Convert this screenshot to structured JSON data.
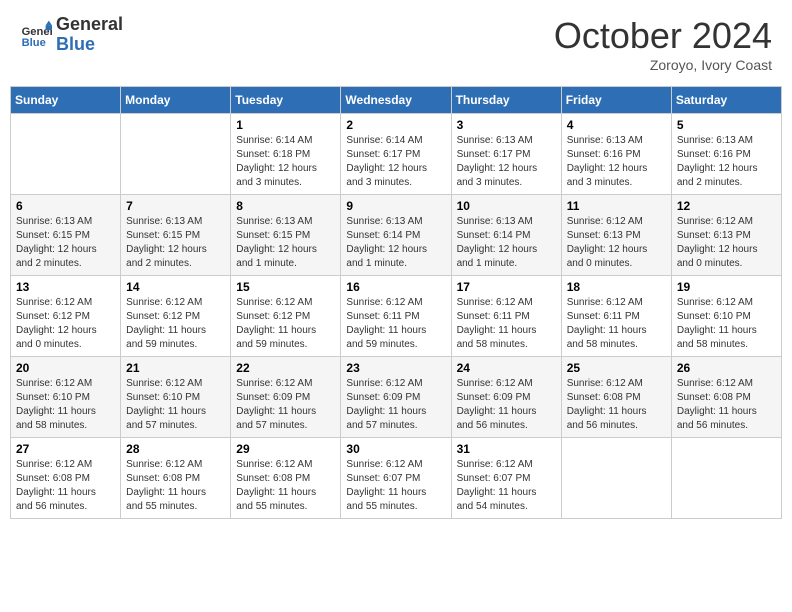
{
  "header": {
    "logo_line1": "General",
    "logo_line2": "Blue",
    "month": "October 2024",
    "location": "Zoroyo, Ivory Coast"
  },
  "days_of_week": [
    "Sunday",
    "Monday",
    "Tuesday",
    "Wednesday",
    "Thursday",
    "Friday",
    "Saturday"
  ],
  "weeks": [
    [
      {
        "day": "",
        "info": ""
      },
      {
        "day": "",
        "info": ""
      },
      {
        "day": "1",
        "info": "Sunrise: 6:14 AM\nSunset: 6:18 PM\nDaylight: 12 hours and 3 minutes."
      },
      {
        "day": "2",
        "info": "Sunrise: 6:14 AM\nSunset: 6:17 PM\nDaylight: 12 hours and 3 minutes."
      },
      {
        "day": "3",
        "info": "Sunrise: 6:13 AM\nSunset: 6:17 PM\nDaylight: 12 hours and 3 minutes."
      },
      {
        "day": "4",
        "info": "Sunrise: 6:13 AM\nSunset: 6:16 PM\nDaylight: 12 hours and 3 minutes."
      },
      {
        "day": "5",
        "info": "Sunrise: 6:13 AM\nSunset: 6:16 PM\nDaylight: 12 hours and 2 minutes."
      }
    ],
    [
      {
        "day": "6",
        "info": "Sunrise: 6:13 AM\nSunset: 6:15 PM\nDaylight: 12 hours and 2 minutes."
      },
      {
        "day": "7",
        "info": "Sunrise: 6:13 AM\nSunset: 6:15 PM\nDaylight: 12 hours and 2 minutes."
      },
      {
        "day": "8",
        "info": "Sunrise: 6:13 AM\nSunset: 6:15 PM\nDaylight: 12 hours and 1 minute."
      },
      {
        "day": "9",
        "info": "Sunrise: 6:13 AM\nSunset: 6:14 PM\nDaylight: 12 hours and 1 minute."
      },
      {
        "day": "10",
        "info": "Sunrise: 6:13 AM\nSunset: 6:14 PM\nDaylight: 12 hours and 1 minute."
      },
      {
        "day": "11",
        "info": "Sunrise: 6:12 AM\nSunset: 6:13 PM\nDaylight: 12 hours and 0 minutes."
      },
      {
        "day": "12",
        "info": "Sunrise: 6:12 AM\nSunset: 6:13 PM\nDaylight: 12 hours and 0 minutes."
      }
    ],
    [
      {
        "day": "13",
        "info": "Sunrise: 6:12 AM\nSunset: 6:12 PM\nDaylight: 12 hours and 0 minutes."
      },
      {
        "day": "14",
        "info": "Sunrise: 6:12 AM\nSunset: 6:12 PM\nDaylight: 11 hours and 59 minutes."
      },
      {
        "day": "15",
        "info": "Sunrise: 6:12 AM\nSunset: 6:12 PM\nDaylight: 11 hours and 59 minutes."
      },
      {
        "day": "16",
        "info": "Sunrise: 6:12 AM\nSunset: 6:11 PM\nDaylight: 11 hours and 59 minutes."
      },
      {
        "day": "17",
        "info": "Sunrise: 6:12 AM\nSunset: 6:11 PM\nDaylight: 11 hours and 58 minutes."
      },
      {
        "day": "18",
        "info": "Sunrise: 6:12 AM\nSunset: 6:11 PM\nDaylight: 11 hours and 58 minutes."
      },
      {
        "day": "19",
        "info": "Sunrise: 6:12 AM\nSunset: 6:10 PM\nDaylight: 11 hours and 58 minutes."
      }
    ],
    [
      {
        "day": "20",
        "info": "Sunrise: 6:12 AM\nSunset: 6:10 PM\nDaylight: 11 hours and 58 minutes."
      },
      {
        "day": "21",
        "info": "Sunrise: 6:12 AM\nSunset: 6:10 PM\nDaylight: 11 hours and 57 minutes."
      },
      {
        "day": "22",
        "info": "Sunrise: 6:12 AM\nSunset: 6:09 PM\nDaylight: 11 hours and 57 minutes."
      },
      {
        "day": "23",
        "info": "Sunrise: 6:12 AM\nSunset: 6:09 PM\nDaylight: 11 hours and 57 minutes."
      },
      {
        "day": "24",
        "info": "Sunrise: 6:12 AM\nSunset: 6:09 PM\nDaylight: 11 hours and 56 minutes."
      },
      {
        "day": "25",
        "info": "Sunrise: 6:12 AM\nSunset: 6:08 PM\nDaylight: 11 hours and 56 minutes."
      },
      {
        "day": "26",
        "info": "Sunrise: 6:12 AM\nSunset: 6:08 PM\nDaylight: 11 hours and 56 minutes."
      }
    ],
    [
      {
        "day": "27",
        "info": "Sunrise: 6:12 AM\nSunset: 6:08 PM\nDaylight: 11 hours and 56 minutes."
      },
      {
        "day": "28",
        "info": "Sunrise: 6:12 AM\nSunset: 6:08 PM\nDaylight: 11 hours and 55 minutes."
      },
      {
        "day": "29",
        "info": "Sunrise: 6:12 AM\nSunset: 6:08 PM\nDaylight: 11 hours and 55 minutes."
      },
      {
        "day": "30",
        "info": "Sunrise: 6:12 AM\nSunset: 6:07 PM\nDaylight: 11 hours and 55 minutes."
      },
      {
        "day": "31",
        "info": "Sunrise: 6:12 AM\nSunset: 6:07 PM\nDaylight: 11 hours and 54 minutes."
      },
      {
        "day": "",
        "info": ""
      },
      {
        "day": "",
        "info": ""
      }
    ]
  ]
}
